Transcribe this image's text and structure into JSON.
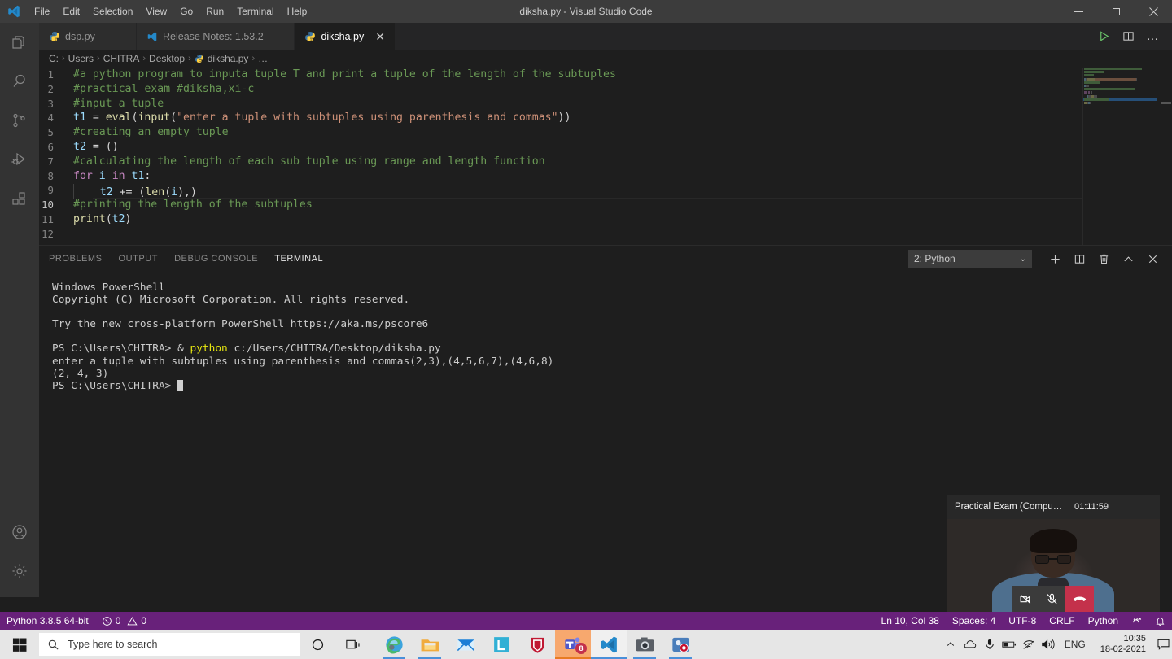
{
  "window": {
    "title": "diksha.py - Visual Studio Code",
    "minimize": "—",
    "maximize": "❐",
    "close": "✕"
  },
  "menu": {
    "items": [
      "File",
      "Edit",
      "Selection",
      "View",
      "Go",
      "Run",
      "Terminal",
      "Help"
    ]
  },
  "activity_bar": {
    "items": [
      {
        "name": "explorer",
        "icon": "files-icon"
      },
      {
        "name": "search",
        "icon": "search-icon"
      },
      {
        "name": "source-control",
        "icon": "source-control-icon"
      },
      {
        "name": "run-debug",
        "icon": "run-debug-icon"
      },
      {
        "name": "extensions",
        "icon": "extensions-icon"
      }
    ],
    "bottom": [
      {
        "name": "accounts",
        "icon": "account-icon"
      },
      {
        "name": "settings",
        "icon": "gear-icon"
      }
    ]
  },
  "tabs": [
    {
      "label": "dsp.py",
      "icon": "python-icon",
      "active": false
    },
    {
      "label": "Release Notes: 1.53.2",
      "icon": "vscode-icon",
      "active": false
    },
    {
      "label": "diksha.py",
      "icon": "python-icon",
      "active": true
    }
  ],
  "editor_actions": {
    "run": "run-python-file-icon",
    "split": "split-editor-icon",
    "more": "…"
  },
  "breadcrumb": {
    "items": [
      "C:",
      "Users",
      "CHITRA",
      "Desktop",
      "diksha.py",
      "…"
    ],
    "separator": "›"
  },
  "code": {
    "lines": [
      {
        "n": "1",
        "tokens": [
          {
            "t": "#a python program to inputa tuple T and print a tuple of the length of the subtuples",
            "c": "cmt"
          }
        ]
      },
      {
        "n": "2",
        "tokens": [
          {
            "t": "#practical exam #diksha,xi-c",
            "c": "cmt"
          }
        ]
      },
      {
        "n": "3",
        "tokens": [
          {
            "t": "#input a tuple",
            "c": "cmt"
          }
        ]
      },
      {
        "n": "4",
        "tokens": [
          {
            "t": "t1",
            "c": "var"
          },
          {
            "t": " = ",
            "c": "op"
          },
          {
            "t": "eval",
            "c": "fn"
          },
          {
            "t": "(",
            "c": "op"
          },
          {
            "t": "input",
            "c": "fn"
          },
          {
            "t": "(",
            "c": "op"
          },
          {
            "t": "\"enter a tuple with subtuples using parenthesis and commas\"",
            "c": "str"
          },
          {
            "t": "))",
            "c": "op"
          }
        ]
      },
      {
        "n": "5",
        "tokens": [
          {
            "t": "#creating an empty tuple",
            "c": "cmt"
          }
        ]
      },
      {
        "n": "6",
        "tokens": [
          {
            "t": "t2",
            "c": "var"
          },
          {
            "t": " = ()",
            "c": "op"
          }
        ]
      },
      {
        "n": "7",
        "tokens": [
          {
            "t": "#calculating the length of each sub tuple using range and length function",
            "c": "cmt"
          }
        ]
      },
      {
        "n": "8",
        "tokens": [
          {
            "t": "for",
            "c": "kw"
          },
          {
            "t": " ",
            "c": "op"
          },
          {
            "t": "i",
            "c": "var"
          },
          {
            "t": " ",
            "c": "op"
          },
          {
            "t": "in",
            "c": "kw"
          },
          {
            "t": " ",
            "c": "op"
          },
          {
            "t": "t1",
            "c": "var"
          },
          {
            "t": ":",
            "c": "op"
          }
        ]
      },
      {
        "n": "9",
        "guide": true,
        "tokens": [
          {
            "t": "    ",
            "c": "op"
          },
          {
            "t": "t2",
            "c": "var"
          },
          {
            "t": " += (",
            "c": "op"
          },
          {
            "t": "len",
            "c": "fn"
          },
          {
            "t": "(",
            "c": "op"
          },
          {
            "t": "i",
            "c": "var"
          },
          {
            "t": "),)",
            "c": "op"
          }
        ]
      },
      {
        "n": "10",
        "current": true,
        "tokens": [
          {
            "t": "#printing the length of the subtuples",
            "c": "cmt"
          }
        ]
      },
      {
        "n": "11",
        "tokens": [
          {
            "t": "print",
            "c": "fn"
          },
          {
            "t": "(",
            "c": "op"
          },
          {
            "t": "t2",
            "c": "var"
          },
          {
            "t": ")",
            "c": "op"
          }
        ]
      },
      {
        "n": "12",
        "tokens": [
          {
            "t": "",
            "c": "op"
          }
        ]
      }
    ]
  },
  "panel": {
    "tabs": [
      {
        "label": "PROBLEMS",
        "active": false
      },
      {
        "label": "OUTPUT",
        "active": false
      },
      {
        "label": "DEBUG CONSOLE",
        "active": false
      },
      {
        "label": "TERMINAL",
        "active": true
      }
    ],
    "terminal_select": "2: Python",
    "actions": [
      {
        "name": "new-terminal",
        "icon": "plus-icon"
      },
      {
        "name": "split-terminal",
        "icon": "split-icon"
      },
      {
        "name": "kill-terminal",
        "icon": "trash-icon"
      },
      {
        "name": "maximize-panel",
        "icon": "chevron-up-icon"
      },
      {
        "name": "close-panel",
        "icon": "close-icon"
      }
    ]
  },
  "terminal": {
    "lines": [
      {
        "text": "Windows PowerShell"
      },
      {
        "text": "Copyright (C) Microsoft Corporation. All rights reserved."
      },
      {
        "text": ""
      },
      {
        "text": "Try the new cross-platform PowerShell https://aka.ms/pscore6"
      },
      {
        "text": ""
      },
      {
        "prompt": "PS C:\\Users\\CHITRA> ",
        "amp": "& ",
        "cmd": "python",
        "arg": " c:/Users/CHITRA/Desktop/diksha.py"
      },
      {
        "text": "enter a tuple with subtuples using parenthesis and commas(2,3),(4,5,6,7),(4,6,8)"
      },
      {
        "text": "(2, 4, 3)"
      },
      {
        "prompt_only": "PS C:\\Users\\CHITRA> "
      }
    ]
  },
  "status_bar": {
    "left": [
      {
        "name": "python-interpreter",
        "label": "Python 3.8.5 64-bit"
      },
      {
        "name": "errors-warnings",
        "errors": "0",
        "warnings": "0"
      }
    ],
    "right": [
      {
        "name": "cursor-position",
        "label": "Ln 10, Col 38"
      },
      {
        "name": "indentation",
        "label": "Spaces: 4"
      },
      {
        "name": "encoding",
        "label": "UTF-8"
      },
      {
        "name": "eol",
        "label": "CRLF"
      },
      {
        "name": "language-mode",
        "label": "Python"
      },
      {
        "name": "feedback",
        "label": "feedback-icon"
      },
      {
        "name": "notifications",
        "label": "bell-icon"
      }
    ]
  },
  "call_widget": {
    "title": "Practical Exam (Compute…",
    "timer": "01:11:59",
    "minimize": "—",
    "controls": [
      {
        "name": "camera-off-button",
        "icon": "camera-off-icon"
      },
      {
        "name": "mic-off-button",
        "icon": "mic-off-icon"
      },
      {
        "name": "hangup-button",
        "icon": "hangup-icon"
      }
    ]
  },
  "taskbar": {
    "start": "windows-logo-icon",
    "search_placeholder": "Type here to search",
    "sys_icons": [
      {
        "name": "cortana-icon"
      },
      {
        "name": "task-view-icon"
      }
    ],
    "apps": [
      {
        "name": "microsoft-edge",
        "running": true
      },
      {
        "name": "file-explorer",
        "running": true
      },
      {
        "name": "mail",
        "running": false
      },
      {
        "name": "lenovo-vantage",
        "running": false
      },
      {
        "name": "mcafee",
        "running": false
      },
      {
        "name": "microsoft-teams",
        "running": true,
        "badge": "8",
        "active": true
      },
      {
        "name": "visual-studio-code",
        "running": true,
        "active": true
      },
      {
        "name": "camera",
        "running": true
      },
      {
        "name": "screen-recorder",
        "running": true
      }
    ],
    "tray": {
      "icons": [
        "show-hidden-icons-chevron",
        "onedrive-icon",
        "microphone-icon",
        "battery-icon",
        "wifi-icon",
        "volume-icon"
      ],
      "language": "ENG",
      "time": "10:35",
      "date": "18-02-2021",
      "notification": "action-center-icon"
    }
  },
  "colors": {
    "accent_purple": "#68217a",
    "editor_bg": "#1e1e1e",
    "titlebar_bg": "#3c3c3c",
    "activitybar_bg": "#333333",
    "comment_green": "#6a9955",
    "string_orange": "#ce9178",
    "keyword_purple": "#c586c0",
    "function_yellow": "#dcdcaa",
    "variable_blue": "#9cdcfe",
    "teams_red": "#c4314b"
  }
}
